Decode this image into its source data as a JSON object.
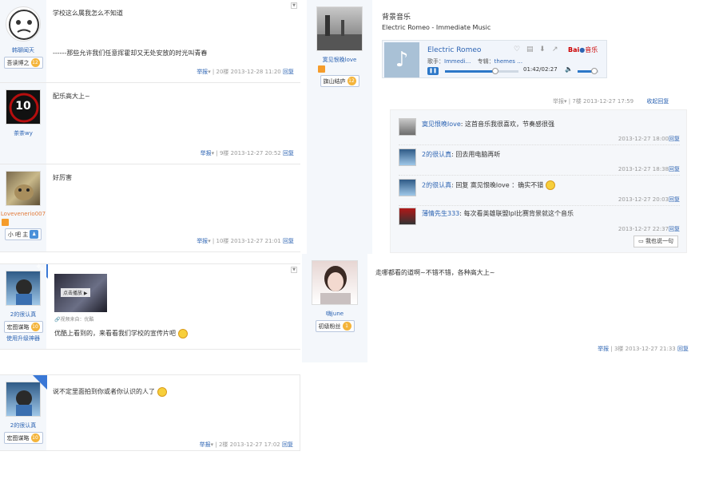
{
  "common": {
    "report": "举报",
    "reply": "回复",
    "collapse_reply": "收起回复"
  },
  "post1": {
    "user": "韩聊闻天",
    "badge": "吾读博之",
    "badge_level": "12",
    "text1": "学校这么属我怎么不知道",
    "text2": "------那些允许我们任意挥霍却又无处安放的时光叫青春",
    "floor": "20楼",
    "time": "2013-12-28 11:20"
  },
  "post2": {
    "user": "茶茶wy",
    "avatar_text": "10",
    "text": "配乐高大上~",
    "floor": "9楼",
    "time": "2013-12-27 20:52"
  },
  "post3": {
    "user": "Lovevenerio007",
    "badge": "小 吧 主",
    "text": "好厉害",
    "floor": "10楼",
    "time": "2013-12-27 21:01"
  },
  "post4": {
    "user": "2的很认真",
    "badge": "宏图谋略",
    "badge_level": "10",
    "upgrade": "使用升级神器",
    "corner": "最佳",
    "video_btn": "点击播放",
    "video_src": "视频来自：优酷",
    "text": "优酷上看到的，来看看我们学校的宣传片吧"
  },
  "post5": {
    "user": "2的很认真",
    "badge": "宏图谋略",
    "corner": "最佳",
    "text": "说不定里面拍到你或者你认识的人了",
    "floor": "2楼",
    "time": "2013-12-27 17:02"
  },
  "music_post": {
    "user": "寞见恨晚love",
    "badge": "旗山结庐",
    "badge_level": "12",
    "title": "背景音乐",
    "subtitle": "Electric Romeo - Immediate Music",
    "song": "Electric Romeo",
    "singer_label": "歌手：",
    "singer": "Immedi…",
    "album_label": "专辑：",
    "album": "themes …",
    "progress": "01:42/02:27",
    "progress_fraction": 0.69,
    "volume_fraction": 0.8,
    "brand": "Bai",
    "brand2": "音乐",
    "floor": "7楼",
    "time": "2013-12-27 17:59"
  },
  "replies": [
    {
      "user": "寞见恨晚love",
      "text": "这首音乐我很喜欢，节奏感很强",
      "time": "2013-12-27 18:00"
    },
    {
      "user": "2的很认真",
      "text": "回去用电脑再听",
      "time": "2013-12-27 18:38"
    },
    {
      "user": "2的很认真",
      "text": "回复 寞见恨晚love ：确实不错",
      "time": "2013-12-27 20:03"
    },
    {
      "user": "薄情先生333",
      "text": "每次看英雄联盟lpl比赛背景就这个音乐",
      "time": "2013-12-27 22:37"
    }
  ],
  "say_button": "我也说一句",
  "post6": {
    "user": "嗨june",
    "badge": "初级粉丝",
    "badge_level": "1",
    "text": "走哪都看的道啊~不错不错，各种高大上~",
    "floor": "3楼",
    "time": "2013-12-27 21:33"
  }
}
